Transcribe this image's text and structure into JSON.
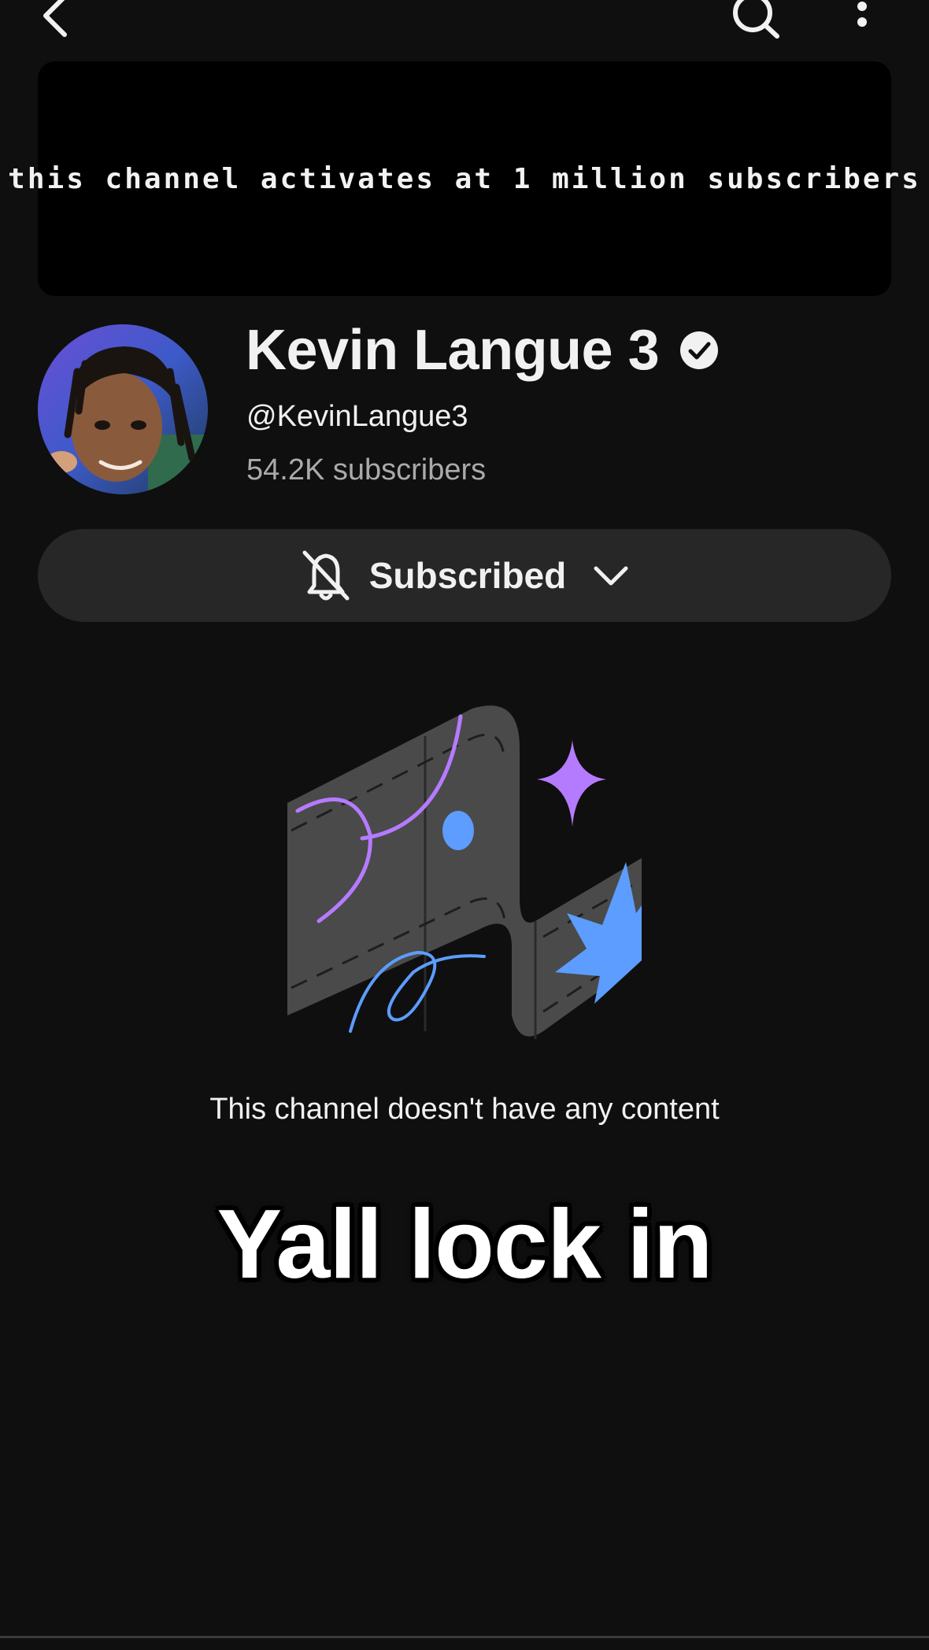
{
  "header": {
    "back_icon": "chevron-left-icon",
    "search_icon": "search-icon",
    "more_icon": "more-vertical-icon"
  },
  "banner": {
    "text": "this channel activates at 1 million subscribers"
  },
  "channel": {
    "name": "Kevin Langue 3",
    "verified_icon": "verified-check-icon",
    "handle": "@KevinLangue3",
    "subscribers": "54.2K subscribers"
  },
  "subscribe_button": {
    "label": "Subscribed",
    "bell_icon": "bell-off-icon",
    "chevron_icon": "chevron-down-icon"
  },
  "empty_state": {
    "message": "This channel doesn't have any content"
  },
  "overlay_caption": "Yall lock in",
  "colors": {
    "background": "#0f0f0f",
    "button_bg": "#272727",
    "secondary_text": "#aaaaaa",
    "purple_accent": "#b57bff",
    "blue_accent": "#5c9dff"
  }
}
